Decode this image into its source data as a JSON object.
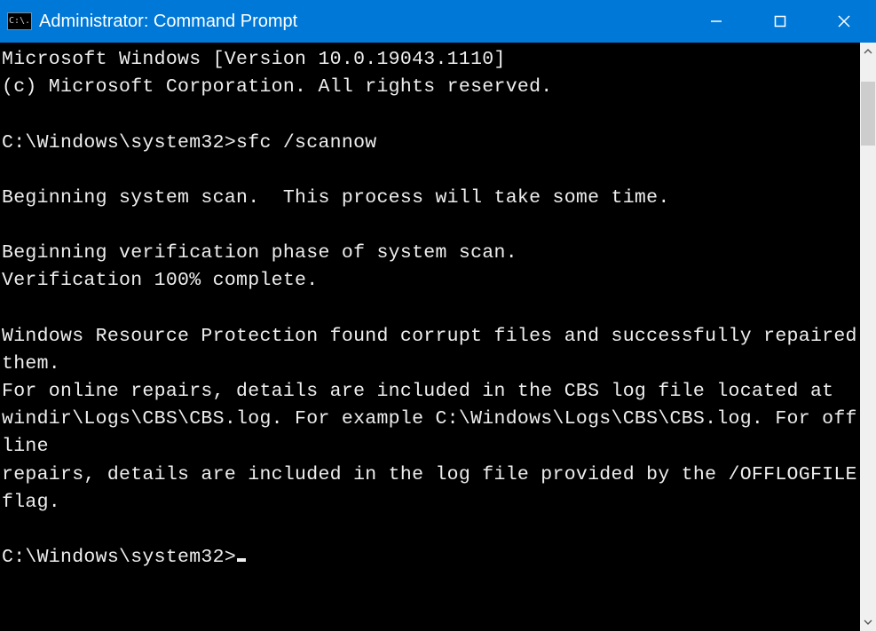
{
  "window": {
    "title": "Administrator: Command Prompt",
    "icon_text": "C:\\."
  },
  "terminal": {
    "line1": "Microsoft Windows [Version 10.0.19043.1110]",
    "line2": "(c) Microsoft Corporation. All rights reserved.",
    "blank1": "",
    "prompt1": "C:\\Windows\\system32>",
    "command1": "sfc /scannow",
    "blank2": "",
    "line3": "Beginning system scan.  This process will take some time.",
    "blank3": "",
    "line4": "Beginning verification phase of system scan.",
    "line5": "Verification 100% complete.",
    "blank4": "",
    "line6": "Windows Resource Protection found corrupt files and successfully repaired them.",
    "line7": "For online repairs, details are included in the CBS log file located at",
    "line8": "windir\\Logs\\CBS\\CBS.log. For example C:\\Windows\\Logs\\CBS\\CBS.log. For offline",
    "line9": "repairs, details are included in the log file provided by the /OFFLOGFILE flag.",
    "blank5": "",
    "prompt2": "C:\\Windows\\system32>"
  },
  "colors": {
    "titlebar": "#0078d7",
    "terminal_bg": "#000000",
    "terminal_fg": "#eeeeee"
  }
}
